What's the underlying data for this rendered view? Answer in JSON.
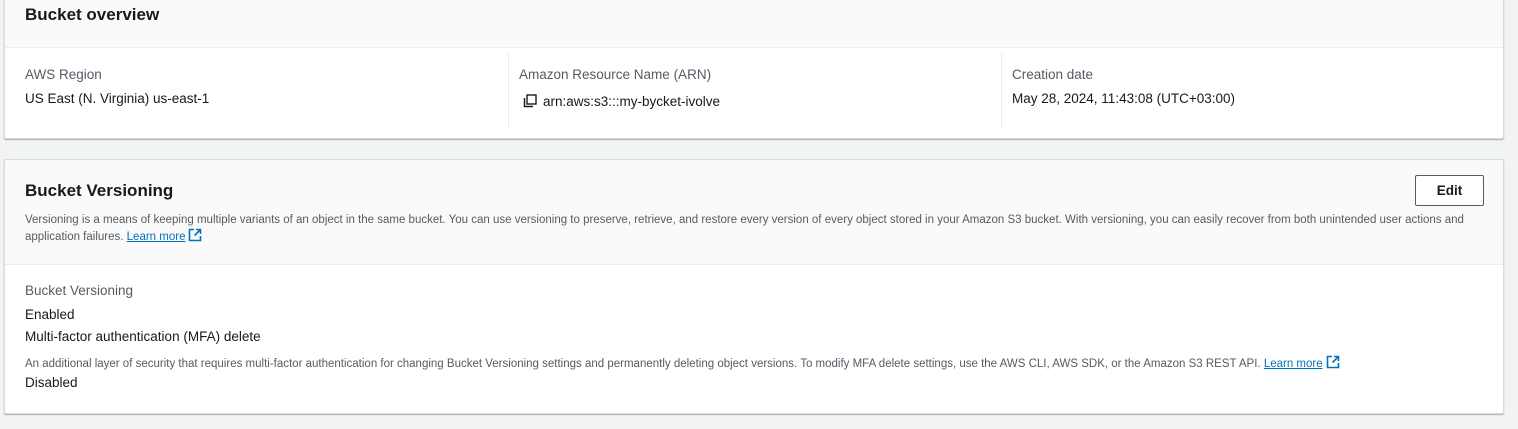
{
  "overview": {
    "title": "Bucket overview",
    "region": {
      "label": "AWS Region",
      "value": "US East (N. Virginia) us-east-1"
    },
    "arn": {
      "label": "Amazon Resource Name (ARN)",
      "value": "arn:aws:s3:::my-bycket-ivolve",
      "icon": "copy-icon"
    },
    "creation": {
      "label": "Creation date",
      "value": "May 28, 2024, 11:43:08 (UTC+03:00)"
    }
  },
  "versioning": {
    "title": "Bucket Versioning",
    "edit_label": "Edit",
    "description": "Versioning is a means of keeping multiple variants of an object in the same bucket. You can use versioning to preserve, retrieve, and restore every version of every object stored in your Amazon S3 bucket. With versioning, you can easily recover from both unintended user actions and application failures.",
    "learn_more": "Learn more",
    "status_label": "Bucket Versioning",
    "status_value": "Enabled",
    "mfa_label": "Multi-factor authentication (MFA) delete",
    "mfa_description": "An additional layer of security that requires multi-factor authentication for changing Bucket Versioning settings and permanently deleting object versions. To modify MFA delete settings, use the AWS CLI, AWS SDK, or the Amazon S3 REST API.",
    "mfa_learn_more": "Learn more",
    "mfa_value": "Disabled"
  },
  "colors": {
    "link": "#0073bb",
    "text": "#16191f",
    "label": "#545b64",
    "page_bg": "#f2f3f3"
  }
}
